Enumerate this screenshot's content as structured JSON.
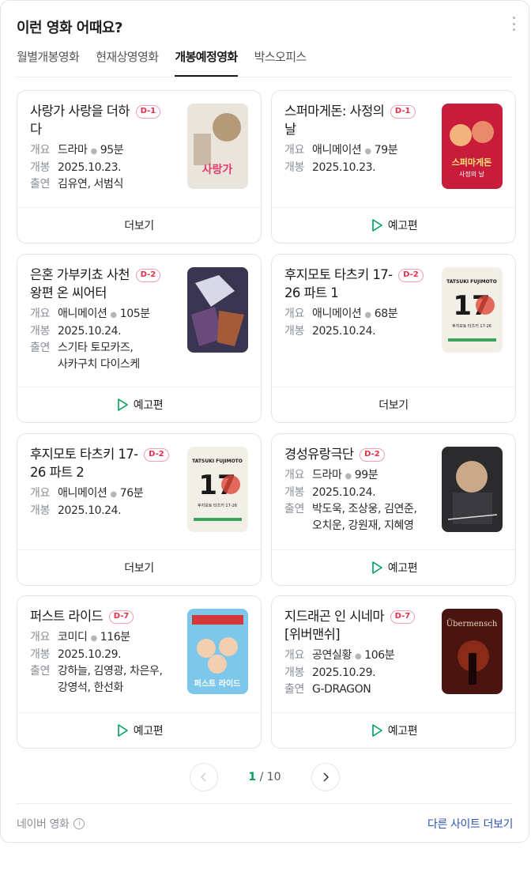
{
  "header": {
    "title": "이런 영화 어때요?"
  },
  "tabs": [
    {
      "label": "월별개봉영화",
      "active": false
    },
    {
      "label": "현재상영영화",
      "active": false
    },
    {
      "label": "개봉예정영화",
      "active": true
    },
    {
      "label": "박스오피스",
      "active": false
    }
  ],
  "labels": {
    "genre": "개요",
    "release": "개봉",
    "cast": "출연"
  },
  "movies": [
    {
      "title_lines": [
        "사랑가 사랑을 더하",
        "다"
      ],
      "dday": "D-1",
      "genre": "드라마",
      "runtime": "95분",
      "release": "2025.10.23.",
      "cast_lines": [
        "김유연, 서범식"
      ],
      "action": "더보기",
      "action_icon": ""
    },
    {
      "title_lines": [
        "스퍼마게돈: 사정의",
        "날"
      ],
      "dday": "D-1",
      "genre": "애니메이션",
      "runtime": "79분",
      "release": "2025.10.23.",
      "cast_lines": [],
      "action": "예고편",
      "action_icon": "play-icon"
    },
    {
      "title_lines": [
        "은혼 가부키쵸 사천",
        "왕편 온 씨어터"
      ],
      "dday": "D-2",
      "genre": "애니메이션",
      "runtime": "105분",
      "release": "2025.10.24.",
      "cast_lines": [
        "스기타 토모카즈,",
        "사카구치 다이스케"
      ],
      "action": "예고편",
      "action_icon": "play-icon"
    },
    {
      "title_lines": [
        "후지모토 타츠키 17-",
        "26 파트 1"
      ],
      "dday": "D-2",
      "genre": "애니메이션",
      "runtime": "68분",
      "release": "2025.10.24.",
      "cast_lines": [],
      "action": "더보기",
      "action_icon": ""
    },
    {
      "title_lines": [
        "후지모토 타츠키 17-",
        "26 파트 2"
      ],
      "dday": "D-2",
      "genre": "애니메이션",
      "runtime": "76분",
      "release": "2025.10.24.",
      "cast_lines": [],
      "action": "더보기",
      "action_icon": ""
    },
    {
      "title_lines": [
        "경성유랑극단"
      ],
      "dday": "D-2",
      "genre": "드라마",
      "runtime": "99분",
      "release": "2025.10.24.",
      "cast_lines": [
        "박도욱, 조상웅, 김연준,",
        "오치운, 강원재, 지혜영"
      ],
      "action": "예고편",
      "action_icon": "play-icon"
    },
    {
      "title_lines": [
        "퍼스트 라이드"
      ],
      "dday": "D-7",
      "genre": "코미디",
      "runtime": "116분",
      "release": "2025.10.29.",
      "cast_lines": [
        "강하늘, 김영광, 차은우,",
        "강영석, 한선화"
      ],
      "action": "예고편",
      "action_icon": "play-icon"
    },
    {
      "title_lines": [
        "지드래곤 인 시네마",
        "[위버맨쉬]"
      ],
      "dday": "D-7",
      "genre": "공연실황",
      "runtime": "106분",
      "release": "2025.10.29.",
      "cast_lines": [
        "G-DRAGON"
      ],
      "action": "예고편",
      "action_icon": "play-icon"
    }
  ],
  "posters": [
    {
      "name": "poster-sarangga",
      "text": "사랑가",
      "bg": "#e9e4dc"
    },
    {
      "name": "poster-spermageddon",
      "text": "스퍼마게돈",
      "sub": "사정의 날",
      "bg": "#c81d3a"
    },
    {
      "name": "poster-gintama",
      "bg": "#3a3550"
    },
    {
      "name": "poster-fujimoto-1",
      "text": "TATSUKI FUJIMOTO",
      "sub": "후지모토 타츠키 17-26",
      "bg": "#f2efe6"
    },
    {
      "name": "poster-fujimoto-2",
      "text": "TATSUKI FUJIMOTO",
      "sub": "후지모토 타츠키 17-26",
      "bg": "#f2efe6"
    },
    {
      "name": "poster-gyeongseong",
      "bg": "#2b2b2e"
    },
    {
      "name": "poster-first-ride",
      "text": "퍼스트 라이드",
      "bg": "#7cc7ea"
    },
    {
      "name": "poster-ubermensch",
      "text": "Übermensch",
      "bg": "#4a1510"
    }
  ],
  "pagination": {
    "current": "1",
    "sep": "/",
    "total": "10"
  },
  "footer": {
    "source": "네이버 영화",
    "more_link": "다른 사이트 더보기"
  },
  "colors": {
    "accent_green": "#00a05a",
    "dday_red": "#e4304a",
    "link_blue": "#2a55b5"
  }
}
